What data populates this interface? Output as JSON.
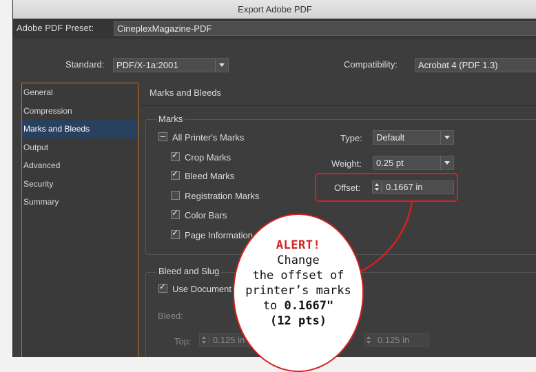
{
  "window": {
    "title": "Export Adobe PDF"
  },
  "preset": {
    "label": "Adobe PDF Preset:",
    "value": "CineplexMagazine-PDF"
  },
  "standard": {
    "label": "Standard:",
    "value": "PDF/X-1a:2001"
  },
  "compatibility": {
    "label": "Compatibility:",
    "value": "Acrobat 4 (PDF 1.3)"
  },
  "sidebar": {
    "items": [
      {
        "label": "General"
      },
      {
        "label": "Compression"
      },
      {
        "label": "Marks and Bleeds",
        "active": true
      },
      {
        "label": "Output"
      },
      {
        "label": "Advanced"
      },
      {
        "label": "Security"
      },
      {
        "label": "Summary"
      }
    ]
  },
  "main": {
    "title": "Marks and Bleeds",
    "marks": {
      "group_title": "Marks",
      "all_printers_marks": "All Printer's Marks",
      "crop_marks": "Crop Marks",
      "bleed_marks": "Bleed Marks",
      "registration_marks": "Registration Marks",
      "color_bars": "Color Bars",
      "page_information": "Page Information",
      "type_label": "Type:",
      "type_value": "Default",
      "weight_label": "Weight:",
      "weight_value": "0.25 pt",
      "offset_label": "Offset:",
      "offset_value": "0.1667 in"
    },
    "bleed_slug": {
      "group_title": "Bleed and Slug",
      "use_document": "Use Document",
      "bleed_label": "Bleed:",
      "top_label": "Top:",
      "top_value": "0.125 in",
      "right_value": "0.125 in"
    }
  },
  "callout": {
    "alert": "ALERT!",
    "line1": "Change",
    "line2": "the offset of",
    "line3": "printer’s marks",
    "line4_prefix": "to ",
    "line4_value": "0.1667\"",
    "line5": "(12 pts)"
  },
  "colors": {
    "accent_orange": "#c8731a",
    "alert_red": "#d62020",
    "selection_blue": "#27415e"
  }
}
